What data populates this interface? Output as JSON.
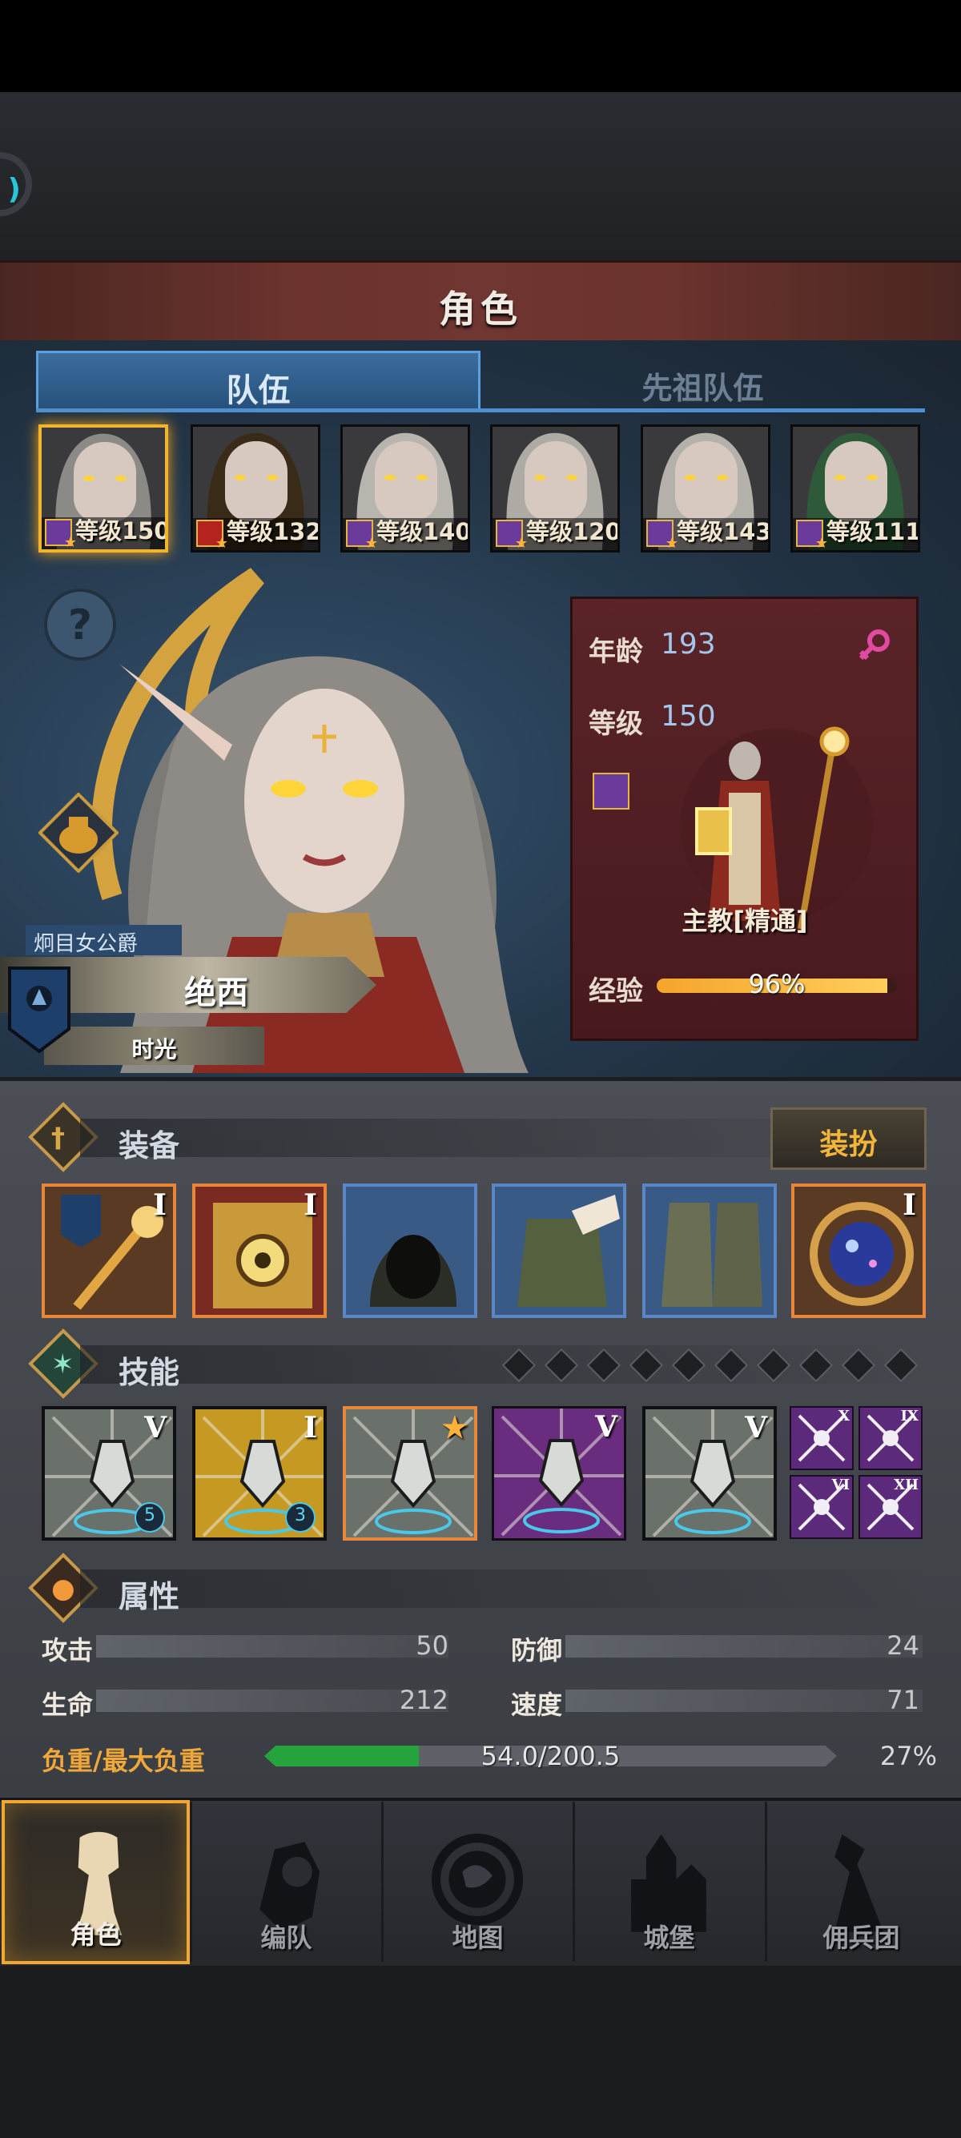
{
  "header": {
    "title": "角色"
  },
  "tabs": [
    {
      "label": "队伍",
      "active": true
    },
    {
      "label": "先祖队伍",
      "active": false
    }
  ],
  "party": [
    {
      "level": "等级150",
      "class_color": "#6b3b9c",
      "selected": true
    },
    {
      "level": "等级132",
      "class_color": "#b5231f",
      "selected": false
    },
    {
      "level": "等级140",
      "class_color": "#6b3b9c",
      "selected": false
    },
    {
      "level": "等级120",
      "class_color": "#6b3b9c",
      "selected": false
    },
    {
      "level": "等级143",
      "class_color": "#6b3b9c",
      "selected": false
    },
    {
      "level": "等级111",
      "class_color": "#6b3b9c",
      "selected": false
    }
  ],
  "hero": {
    "title": "炯目女公爵",
    "name": "绝西",
    "subtitle": "时光",
    "help_glyph": "?"
  },
  "info": {
    "age_label": "年龄",
    "age": "193",
    "level_label": "等级",
    "level": "150",
    "job": "主教[精通]",
    "exp_label": "经验",
    "exp_text": "96%",
    "exp_fraction": 0.96
  },
  "equipment": {
    "label": "装备",
    "outfit_button": "装扮",
    "slots": [
      {
        "name": "staff",
        "rank": "I"
      },
      {
        "name": "tome",
        "rank": "I"
      },
      {
        "name": "hood",
        "rank": ""
      },
      {
        "name": "tunic",
        "rank": ""
      },
      {
        "name": "boots",
        "rank": ""
      },
      {
        "name": "astral-orb",
        "rank": "I"
      }
    ]
  },
  "skills": {
    "label": "技能",
    "pips": 10,
    "slots": [
      {
        "name": "skill-1",
        "rank": "V",
        "badge": "5"
      },
      {
        "name": "skill-2",
        "rank": "I",
        "badge": "3"
      },
      {
        "name": "skill-3",
        "rank": "★",
        "badge": ""
      },
      {
        "name": "skill-4",
        "rank": "V",
        "badge": ""
      },
      {
        "name": "skill-5",
        "rank": "V",
        "badge": ""
      }
    ],
    "mini": [
      {
        "rank": "X"
      },
      {
        "rank": "IX"
      },
      {
        "rank": "VI"
      },
      {
        "rank": "XII"
      }
    ]
  },
  "attributes": {
    "label": "属性",
    "attack_label": "攻击",
    "attack": "50",
    "defense_label": "防御",
    "defense": "24",
    "hp_label": "生命",
    "hp": "212",
    "speed_label": "速度",
    "speed": "71",
    "load_label": "负重/最大负重",
    "load_text": "54.0/200.5",
    "load_pct": "27%",
    "load_fraction": 0.27
  },
  "nav": [
    {
      "label": "角色",
      "active": true
    },
    {
      "label": "编队",
      "active": false
    },
    {
      "label": "地图",
      "active": false
    },
    {
      "label": "城堡",
      "active": false
    },
    {
      "label": "佣兵团",
      "active": false
    }
  ],
  "colors": {
    "accent": "#f2a72e",
    "tab_blue": "#4d8fd0",
    "card_red": "#5a2428"
  }
}
